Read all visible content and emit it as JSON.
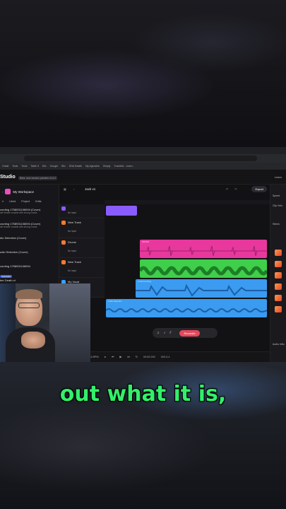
{
  "browser": {
    "bookmarks": [
      "Gmail",
      "Tools",
      "Tools",
      "Table It",
      "Wix",
      "Google",
      "Wix",
      "DNA Health",
      "My Agencies",
      "Simply",
      "TrackMix - Learn..."
    ]
  },
  "app": {
    "title": "Studio",
    "beta_label": "Beta: new version preview v0.4.0",
    "learn_label": "Learn"
  },
  "sidebar": {
    "workspace_name": "My Workspace",
    "filters": [
      "Liked",
      "Project",
      "Edits"
    ],
    "songs": [
      {
        "title": "cording 1758931106094 (Cover)",
        "subtitle": "ale female vocalist with strong vocals",
        "tag": ""
      },
      {
        "title": "cording 1758931106094 (Cover)",
        "subtitle": "ale female vocalist with strong vocals",
        "tag": ""
      },
      {
        "title": "dio Selection (Cover)",
        "subtitle": "",
        "tag": ""
      },
      {
        "title": "udio Selection (Cover)",
        "subtitle": "",
        "tag": ""
      },
      {
        "title": "cording 1758931106094",
        "subtitle": "",
        "tag": "Uploaded"
      },
      {
        "title": "ber Death vt",
        "subtitle": "",
        "tag": ""
      }
    ]
  },
  "project": {
    "name": "Jack v1",
    "export_label": "Export"
  },
  "tracks": [
    {
      "name": "",
      "input": "No Input",
      "color": "#8a5cff"
    },
    {
      "name": "New Track",
      "input": "No Input",
      "color": "#ff7a2f"
    },
    {
      "name": "Drums",
      "input": "No Input",
      "color": "#ff7a2f"
    },
    {
      "name": "New Track",
      "input": "No Input",
      "color": "#ff7a2f"
    },
    {
      "name": "My Vocal",
      "input": "",
      "color": "#3aa0ff"
    }
  ],
  "clips": {
    "drums_label": "DRUMS",
    "vocal_label": "vocal recording",
    "extra_label": "Audio Selection"
  },
  "toolbar": {
    "recreate_label": "Recreate"
  },
  "transport": {
    "bpm": "124 BPM",
    "time": "00:00.000",
    "position": "003.3.4"
  },
  "right_panel": {
    "speed_label": "Speed",
    "clip_volume_label": "Clip Volu",
    "stems_label": "Stems",
    "audio_label": "Audio Influ"
  },
  "caption": {
    "text": "out what it is,"
  }
}
